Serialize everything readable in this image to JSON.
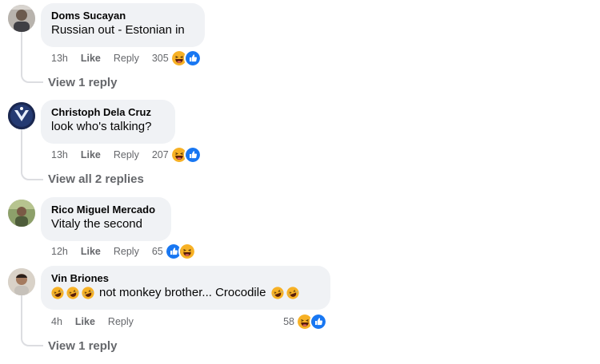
{
  "comments": [
    {
      "author": "Doms Sucayan",
      "text": "Russian out - Estonian in",
      "time": "13h",
      "like_label": "Like",
      "reply_label": "Reply",
      "reaction_count": "305",
      "reactions": [
        "haha",
        "like"
      ],
      "view_replies": "View 1 reply"
    },
    {
      "author": "Christoph Dela Cruz",
      "text": "look who's talking?",
      "time": "13h",
      "like_label": "Like",
      "reply_label": "Reply",
      "reaction_count": "207",
      "reactions": [
        "haha",
        "like"
      ],
      "view_replies": "View all 2 replies"
    },
    {
      "author": "Rico Miguel Mercado",
      "text": "Vitaly the second",
      "time": "12h",
      "like_label": "Like",
      "reply_label": "Reply",
      "reaction_count": "65",
      "reactions": [
        "like",
        "haha"
      ]
    },
    {
      "author": "Vin Briones",
      "text": "not monkey brother... Crocodile",
      "leading_emoji": [
        "rofl",
        "rofl",
        "rofl"
      ],
      "trailing_emoji": [
        "rofl",
        "rofl"
      ],
      "time": "4h",
      "like_label": "Like",
      "reply_label": "Reply",
      "reaction_count": "58",
      "reactions": [
        "haha",
        "like"
      ],
      "view_replies": "View 1 reply"
    }
  ],
  "colors": {
    "bubble": "#f0f2f5",
    "meta": "#65676b",
    "like_blue": "#1877f2",
    "haha_yellow": "#f7b125"
  }
}
